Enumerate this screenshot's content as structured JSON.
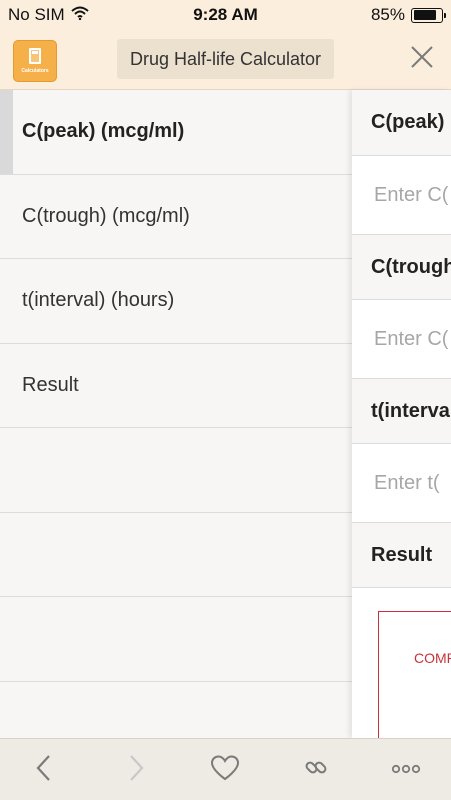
{
  "status_bar": {
    "carrier": "No SIM",
    "time": "9:28 AM",
    "battery_percent": "85%",
    "battery_level": 0.85
  },
  "nav": {
    "app_icon_label": "Calculators",
    "title": "Drug Half-life Calculator",
    "close_icon": "close-icon"
  },
  "sidebar": {
    "items": [
      {
        "label": "C(peak) (mcg/ml)",
        "active": true
      },
      {
        "label": "C(trough) (mcg/ml)",
        "active": false
      },
      {
        "label": "t(interval) (hours)",
        "active": false
      },
      {
        "label": "Result",
        "active": false
      },
      {
        "label": "",
        "active": false
      },
      {
        "label": "",
        "active": false
      },
      {
        "label": "",
        "active": false
      },
      {
        "label": "",
        "active": false
      }
    ]
  },
  "form": {
    "sections": [
      {
        "header": "C(peak)",
        "placeholder": "Enter C("
      },
      {
        "header": "C(trough",
        "placeholder": "Enter C("
      },
      {
        "header": "t(interva",
        "placeholder": "Enter t("
      }
    ],
    "result_header": "Result",
    "result_text": "COMP"
  },
  "toolbar": {
    "back_icon": "chevron-left-icon",
    "forward_icon": "chevron-right-icon",
    "favorite_icon": "heart-icon",
    "link_icon": "link-icon",
    "more_icon": "more-icon"
  },
  "colors": {
    "bar_bg": "#fbeedd",
    "accent_red": "#c9323a",
    "icon_orange": "#f6b04a"
  }
}
